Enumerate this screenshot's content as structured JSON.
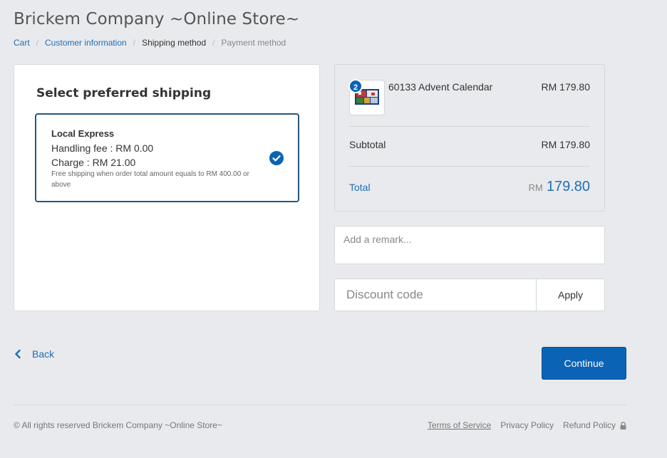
{
  "header": {
    "store_title": "Brickem Company ~Online Store~"
  },
  "breadcrumb": {
    "cart": "Cart",
    "customer_information": "Customer information",
    "shipping_method": "Shipping method",
    "payment_method": "Payment method",
    "separator": "/"
  },
  "shipping": {
    "title": "Select preferred shipping",
    "option": {
      "name": "Local Express",
      "handling_fee": "Handling fee : RM 0.00",
      "charge": "Charge : RM 21.00",
      "note": "Free shipping when order total amount equals to RM 400.00 or above",
      "selected": true
    }
  },
  "summary": {
    "item": {
      "quantity": "2",
      "name": "60133 Advent Calendar",
      "price": "RM 179.80"
    },
    "subtotal_label": "Subtotal",
    "subtotal_value": "RM 179.80",
    "total_label": "Total",
    "total_currency": "RM",
    "total_amount": "179.80"
  },
  "remark": {
    "placeholder": "Add a remark..."
  },
  "discount": {
    "placeholder": "Discount code",
    "apply_label": "Apply"
  },
  "nav": {
    "back_label": "Back",
    "continue_label": "Continue"
  },
  "footer": {
    "copyright": "© All rights reserved Brickem Company ~Online Store~",
    "terms": "Terms of Service",
    "privacy": "Privacy Policy",
    "refund": "Refund Policy"
  },
  "colors": {
    "accent": "#0a63b5",
    "link": "#1f6fb5",
    "background": "#e9eaed",
    "selected_border": "#24587e"
  }
}
